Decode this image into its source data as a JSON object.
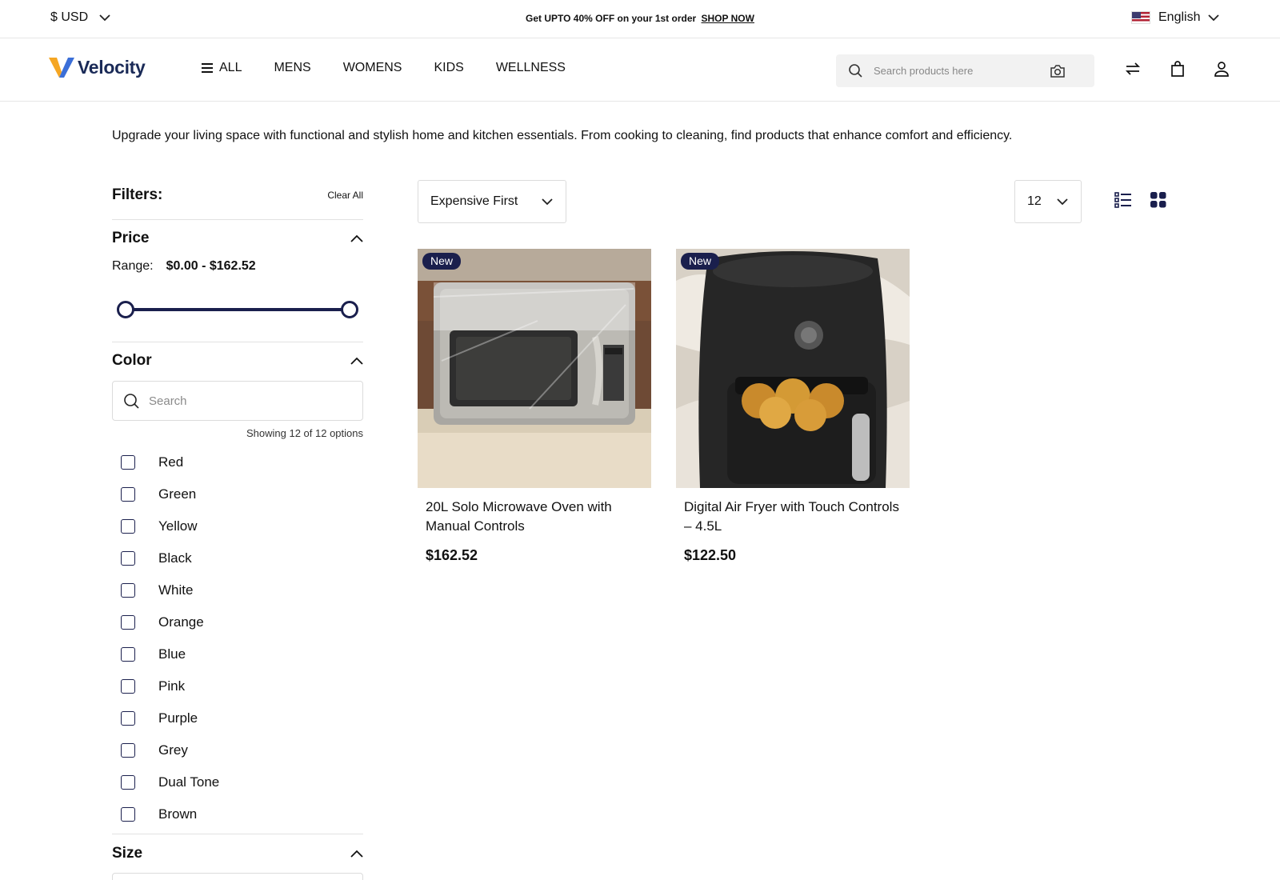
{
  "topbar": {
    "currency": "$ USD",
    "promo_text": "Get UPTO 40% OFF on your 1st order",
    "promo_link": "SHOP NOW",
    "language": "English"
  },
  "header": {
    "logo_text": "Velocity",
    "nav": [
      "ALL",
      "MENS",
      "WOMENS",
      "KIDS",
      "WELLNESS"
    ],
    "search_placeholder": "Search products here"
  },
  "intro": "Upgrade your living space with functional and stylish home and kitchen essentials. From cooking to cleaning, find products that enhance comfort and efficiency.",
  "filters": {
    "title": "Filters:",
    "clear_all": "Clear All",
    "price": {
      "title": "Price",
      "range_label": "Range:",
      "range_value": "$0.00 - $162.52"
    },
    "color": {
      "title": "Color",
      "search_placeholder": "Search",
      "showing": "Showing 12 of 12 options",
      "options": [
        "Red",
        "Green",
        "Yellow",
        "Black",
        "White",
        "Orange",
        "Blue",
        "Pink",
        "Purple",
        "Grey",
        "Dual Tone",
        "Brown"
      ]
    },
    "size": {
      "title": "Size"
    }
  },
  "toolbar": {
    "sort": "Expensive First",
    "per_page": "12"
  },
  "products": [
    {
      "badge": "New",
      "title": "20L Solo Microwave Oven with Manual Controls",
      "price": "$162.52"
    },
    {
      "badge": "New",
      "title": "Digital Air Fryer with Touch Controls – 4.5L",
      "price": "$122.50"
    }
  ],
  "colors": {
    "brand_navy": "#1a1f4d",
    "logo_orange": "#f5a623",
    "logo_blue": "#3b6fd8"
  },
  "icons": [
    "chevron-down-icon",
    "menu-icon",
    "search-icon",
    "camera-icon",
    "compare-icon",
    "bag-icon",
    "user-icon",
    "chevron-up-icon",
    "list-view-icon",
    "grid-view-icon"
  ]
}
